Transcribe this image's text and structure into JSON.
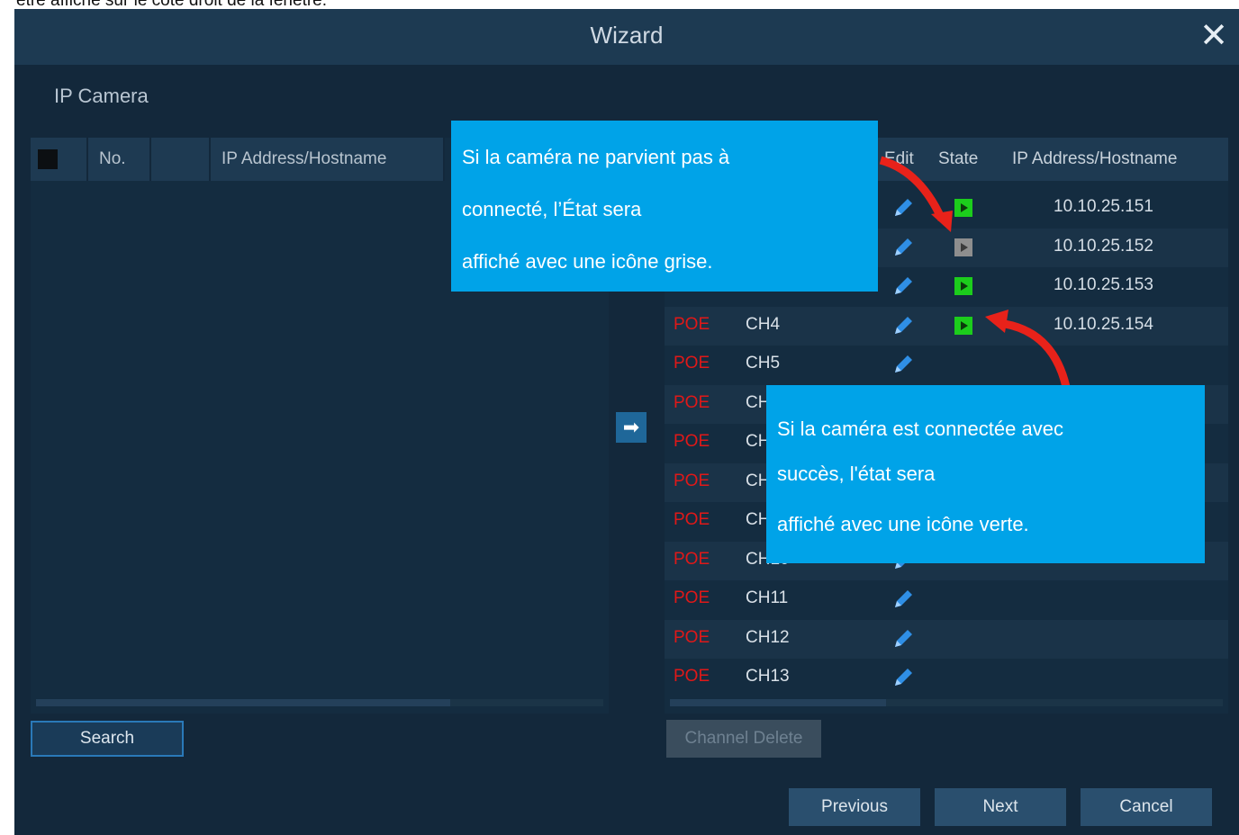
{
  "page": {
    "caption": "être affiché sur le côté droit de la fenêtre."
  },
  "window": {
    "title": "Wizard",
    "close_icon": "close-icon",
    "section_title": "IP Camera"
  },
  "left_table": {
    "headers": [
      "No.",
      "",
      "IP Address/Hostname"
    ]
  },
  "right_table": {
    "headers": [
      "Edit",
      "State",
      "IP Address/Hostname"
    ],
    "rows": [
      {
        "poe": "",
        "channel": "",
        "state": "green",
        "ip": "10.10.25.151"
      },
      {
        "poe": "",
        "channel": "",
        "state": "gray",
        "ip": "10.10.25.152"
      },
      {
        "poe": "",
        "channel": "",
        "state": "green",
        "ip": "10.10.25.153"
      },
      {
        "poe": "POE",
        "channel": "CH4",
        "state": "green",
        "ip": "10.10.25.154"
      },
      {
        "poe": "POE",
        "channel": "CH5",
        "state": "",
        "ip": ""
      },
      {
        "poe": "POE",
        "channel": "CH6",
        "state": "",
        "ip": ""
      },
      {
        "poe": "POE",
        "channel": "CH7",
        "state": "",
        "ip": ""
      },
      {
        "poe": "POE",
        "channel": "CH8",
        "state": "",
        "ip": ""
      },
      {
        "poe": "POE",
        "channel": "CH9",
        "state": "",
        "ip": ""
      },
      {
        "poe": "POE",
        "channel": "CH10",
        "state": "",
        "ip": ""
      },
      {
        "poe": "POE",
        "channel": "CH11",
        "state": "",
        "ip": ""
      },
      {
        "poe": "POE",
        "channel": "CH12",
        "state": "",
        "ip": ""
      },
      {
        "poe": "POE",
        "channel": "CH13",
        "state": "",
        "ip": ""
      }
    ]
  },
  "buttons": {
    "search": "Search",
    "channel_delete": "Channel Delete",
    "previous": "Previous",
    "next": "Next",
    "cancel": "Cancel"
  },
  "callouts": {
    "failed": [
      "Si la caméra ne parvient pas à",
      "connecté, l’État sera",
      "affiché avec une icône grise."
    ],
    "success": [
      "Si la caméra est connectée avec",
      "succès, l'état sera",
      "affiché avec une icône verte."
    ]
  },
  "colors": {
    "callout_bg": "#00a3e8",
    "arrow_red": "#e8221a",
    "state_connected": "#1ccd1c",
    "state_failed": "#8e8e8e",
    "poe_label": "#e01818"
  }
}
